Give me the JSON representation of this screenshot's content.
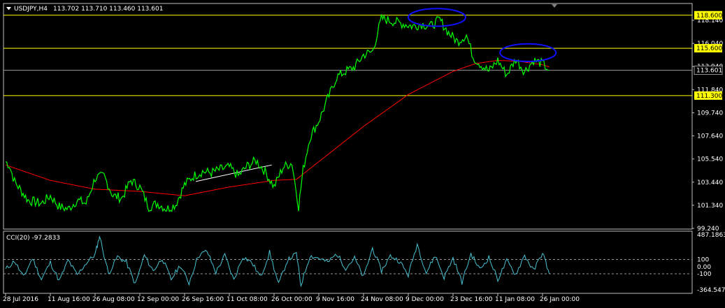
{
  "header": {
    "symbol_label": "USDJPY,H4",
    "ohlc_text": "113.702 113.710 113.460 113.601"
  },
  "colors": {
    "background": "#000000",
    "frame": "#c0c0c0",
    "price_line": "#00ff00",
    "moving_average": "#ff0000",
    "horizontal_levels": "#ffff00",
    "level_label_bg": "#ffff00",
    "current_price_line": "#9a9a9a",
    "ellipse": "#1010ff",
    "trendline": "#ffffff",
    "cci_line": "#48c0d0"
  },
  "chart_data": [
    {
      "type": "line",
      "name": "price",
      "title": "USDJPY,H4",
      "ylim": [
        99.24,
        119.6
      ],
      "y_ticks": [
        {
          "value": 118.14,
          "label": "118.140"
        },
        {
          "value": 116.04,
          "label": "116.040"
        },
        {
          "value": 113.94,
          "label": "113.940"
        },
        {
          "value": 111.84,
          "label": "111.840"
        },
        {
          "value": 109.74,
          "label": "109.740"
        },
        {
          "value": 107.64,
          "label": "107.640"
        },
        {
          "value": 105.54,
          "label": "105.540"
        },
        {
          "value": 103.44,
          "label": "103.440"
        },
        {
          "value": 101.34,
          "label": "101.340"
        },
        {
          "value": 99.24,
          "label": "99.240"
        }
      ],
      "x_ticks": [
        "28 Jul 2016",
        "11 Aug 16:00",
        "26 Aug 08:00",
        "12 Sep 00:00",
        "26 Sep 16:00",
        "11 Oct 08:00",
        "26 Oct 00:00",
        "9 Nov 16:00",
        "24 Nov 08:00",
        "9 Dec 00:00",
        "23 Dec 16:00",
        "11 Jan 08:00",
        "26 Jan 00:00"
      ],
      "x_tick_index": [
        0,
        1,
        2,
        3,
        4,
        5,
        6,
        7,
        8,
        9,
        10,
        11,
        12
      ],
      "series": [
        {
          "name": "USDJPY",
          "x": [
            0,
            0.08,
            0.2,
            0.5,
            0.8,
            1.0,
            1.2,
            1.4,
            1.6,
            1.8,
            2.0,
            2.2,
            2.4,
            2.6,
            2.8,
            3.0,
            3.2,
            3.4,
            3.6,
            3.8,
            4.0,
            4.2,
            4.4,
            4.6,
            4.8,
            5.0,
            5.2,
            5.4,
            5.6,
            5.8,
            6.0,
            6.2,
            6.4,
            6.55,
            6.65,
            6.8,
            7.0,
            7.2,
            7.4,
            7.6,
            7.8,
            8.0,
            8.2,
            8.4,
            8.6,
            8.8,
            9.0,
            9.1,
            9.3,
            9.5,
            9.7,
            9.9,
            10.1,
            10.3,
            10.45,
            10.6,
            10.8,
            11.0,
            11.2,
            11.4,
            11.6,
            11.8,
            12.0,
            12.15
          ],
          "values": [
            105.3,
            105.0,
            103.5,
            101.8,
            101.5,
            102.2,
            101.2,
            101.0,
            101.8,
            101.5,
            103.8,
            104.0,
            102.2,
            102.0,
            103.6,
            103.0,
            101.2,
            101.5,
            101.0,
            101.4,
            103.2,
            104.0,
            104.4,
            104.3,
            104.6,
            104.8,
            104.0,
            104.9,
            105.4,
            104.4,
            103.0,
            104.8,
            105.2,
            101.2,
            104.6,
            107.5,
            109.0,
            111.0,
            113.0,
            113.5,
            113.9,
            115.0,
            115.3,
            118.3,
            118.1,
            117.9,
            117.7,
            117.6,
            117.8,
            117.6,
            118.2,
            117.0,
            116.2,
            116.8,
            114.8,
            114.2,
            113.5,
            114.5,
            113.2,
            114.6,
            113.5,
            114.5,
            114.2,
            113.6
          ]
        },
        {
          "name": "moving average",
          "x": [
            0,
            1,
            2,
            3,
            4,
            5,
            6,
            6.5,
            7,
            8,
            9,
            10,
            10.5,
            11,
            11.5,
            12,
            12.15
          ],
          "values": [
            105.0,
            103.6,
            102.8,
            102.6,
            102.2,
            103.0,
            103.6,
            103.7,
            105.3,
            108.5,
            111.4,
            113.5,
            114.2,
            114.5,
            114.4,
            114.1,
            113.9
          ]
        }
      ],
      "horizontal_levels": [
        {
          "value": 118.6,
          "label": "118.600"
        },
        {
          "value": 115.6,
          "label": "115.600"
        },
        {
          "value": 111.3,
          "label": "111.300"
        }
      ],
      "current_price": {
        "value": 113.601,
        "label": "113.601"
      },
      "annotations": [
        {
          "kind": "ellipse",
          "x_from": 9.0,
          "x_to": 10.28,
          "y_from": 117.6,
          "y_to": 119.2
        },
        {
          "kind": "ellipse",
          "x_from": 11.05,
          "x_to": 12.3,
          "y_from": 114.4,
          "y_to": 116.0
        },
        {
          "kind": "trendline",
          "x_from": 4.25,
          "x_to": 5.95,
          "y_from": 103.5,
          "y_to": 105.0
        }
      ]
    },
    {
      "type": "line",
      "name": "indicator",
      "title": "CCI(20) -97.2833",
      "ylim": [
        -364.5479,
        487.1863
      ],
      "y_ticks": [
        {
          "value": 487.1863,
          "label": "487.1863"
        },
        {
          "value": 100,
          "label": "100"
        },
        {
          "value": 0,
          "label": "0.00"
        },
        {
          "value": -100,
          "label": "-100"
        },
        {
          "value": -364.5479,
          "label": "-364.5479"
        }
      ],
      "reference_levels": [
        100,
        -100
      ],
      "series": [
        {
          "name": "CCI(20)",
          "x": [
            0,
            0.2,
            0.4,
            0.6,
            0.8,
            1.0,
            1.2,
            1.4,
            1.6,
            1.8,
            2.0,
            2.1,
            2.3,
            2.5,
            2.7,
            2.9,
            3.1,
            3.3,
            3.5,
            3.7,
            3.9,
            4.1,
            4.3,
            4.5,
            4.7,
            4.9,
            5.1,
            5.3,
            5.5,
            5.7,
            5.9,
            6.1,
            6.3,
            6.5,
            6.6,
            6.8,
            7.0,
            7.2,
            7.4,
            7.6,
            7.8,
            8.0,
            8.2,
            8.4,
            8.6,
            8.8,
            9.0,
            9.2,
            9.4,
            9.6,
            9.8,
            10.0,
            10.2,
            10.4,
            10.6,
            10.8,
            11.0,
            11.2,
            11.4,
            11.6,
            11.8,
            12.0,
            12.15
          ],
          "values": [
            -40,
            80,
            -150,
            120,
            -180,
            60,
            -200,
            90,
            -120,
            50,
            170,
            430,
            -100,
            140,
            60,
            -250,
            160,
            -60,
            120,
            -180,
            20,
            -230,
            150,
            220,
            -80,
            160,
            -190,
            140,
            60,
            -150,
            200,
            -250,
            90,
            180,
            -260,
            150,
            120,
            60,
            180,
            -20,
            120,
            -150,
            260,
            -60,
            150,
            80,
            -120,
            320,
            -90,
            160,
            -150,
            120,
            -220,
            180,
            -40,
            130,
            -180,
            80,
            -110,
            160,
            -60,
            200,
            -97
          ]
        }
      ]
    }
  ]
}
